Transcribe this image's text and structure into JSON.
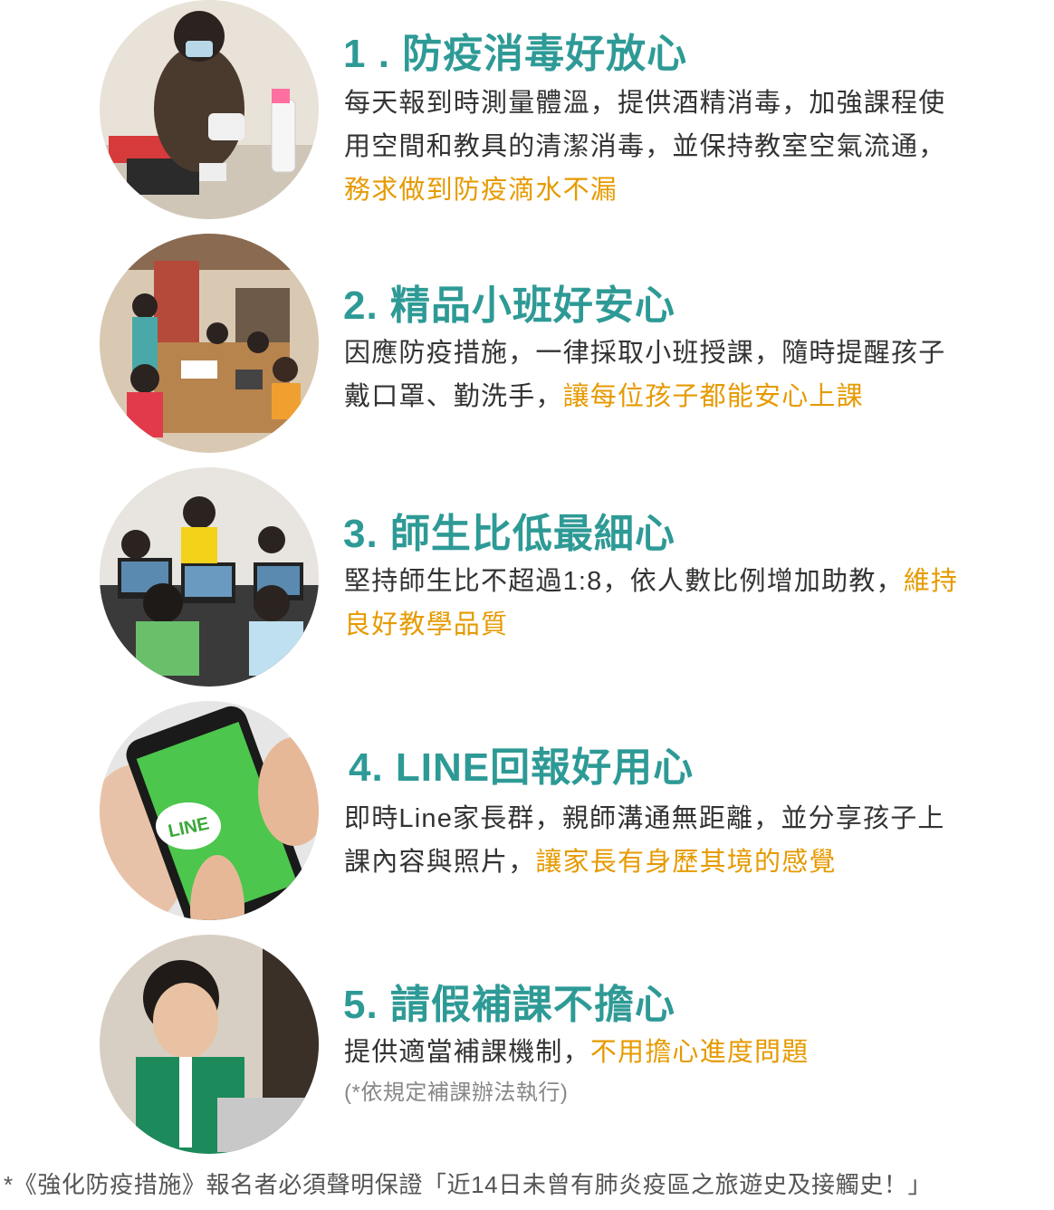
{
  "items": [
    {
      "title": "1 . 防疫消毒好放心",
      "desc": "每天報到時測量體溫，提供酒精消毒，加強課程使用空間和教具的清潔消毒，並保持教室空氣流通，",
      "highlight": "務求做到防疫滴水不漏"
    },
    {
      "title": "2. 精品小班好安心",
      "desc": "因應防疫措施，一律採取小班授課，隨時提醒孩子戴口罩、勤洗手，",
      "highlight": "讓每位孩子都能安心上課"
    },
    {
      "title": "3. 師生比低最細心",
      "desc": "堅持師生比不超過1:8，依人數比例增加助教，",
      "highlight": "維持良好教學品質"
    },
    {
      "title": "4. LINE回報好用心",
      "desc": "即時Line家長群，親師溝通無距離，並分享孩子上課內容與照片，",
      "highlight": "讓家長有身歷其境的感覺",
      "logo_text": "LINE"
    },
    {
      "title": "5. 請假補課不擔心",
      "desc": "提供適當補課機制，",
      "highlight": "不用擔心進度問題",
      "note": "(*依規定補課辦法執行)"
    }
  ],
  "footer": "*《強化防疫措施》報名者必須聲明保證「近14日未曾有肺炎疫區之旅遊史及接觸史！」",
  "colors": {
    "title": "#2e9a96",
    "highlight": "#e69a00",
    "text": "#333333"
  }
}
